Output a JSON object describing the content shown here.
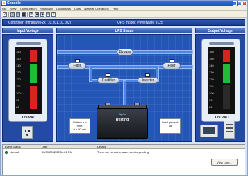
{
  "window": {
    "title": "Console"
  },
  "menu": [
    "File",
    "View",
    "Configuration",
    "Shutdown",
    "Diagnostics",
    "Logs",
    "Network Operations",
    "Help"
  ],
  "controller": {
    "label": "Controller:",
    "value": "mmaxwell-2k (10.201.10.102)",
    "model_label": "UPS model:",
    "model_value": "Powerware 9125"
  },
  "panels": {
    "input": "Input Voltage",
    "status": "UPS Status",
    "output": "Output Voltage"
  },
  "meters": {
    "ticks": [
      "160",
      "150",
      "140",
      "130",
      "120",
      "110",
      "100",
      "90",
      "80"
    ],
    "input_reading": "120 VAC",
    "output_reading": "120 VAC"
  },
  "nodes": {
    "filter_in": "Filter",
    "bypass": "Bypass",
    "rectifier": "Rectifier",
    "inverter": "Inverter",
    "filter_out": "Filter"
  },
  "battery": {
    "logo": "Alpha",
    "state": "Resting",
    "runtime_label": "Battery run time:",
    "runtime_value": "0 h 50 min",
    "load_label": "Load percent:",
    "load_value": "18"
  },
  "events": {
    "columns": [
      "Event Status",
      "Date",
      "Details"
    ],
    "rows": [
      {
        "status": "Normal",
        "date": "02/09/2002 02:54:21 PM",
        "details": "There are no active alarm events pending."
      }
    ],
    "view_logs": "View Logs..."
  }
}
